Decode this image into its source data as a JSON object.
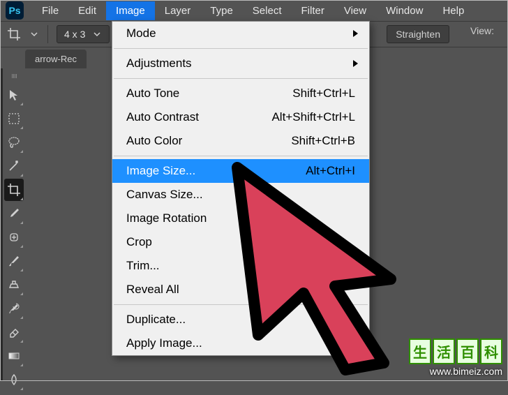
{
  "app": {
    "logo_text": "Ps"
  },
  "menubar": {
    "items": [
      "File",
      "Edit",
      "Image",
      "Layer",
      "Type",
      "Select",
      "Filter",
      "View",
      "Window",
      "Help"
    ],
    "active_index": 2
  },
  "options_bar": {
    "ratio": "4 x 3",
    "straighten": "Straighten",
    "view_label": "View:"
  },
  "document_tab": {
    "title": "arrow-Rec"
  },
  "dropdown": {
    "groups": [
      [
        {
          "label": "Mode",
          "submenu": true
        },
        "sep",
        {
          "label": "Adjustments",
          "submenu": true
        }
      ],
      [
        {
          "label": "Auto Tone",
          "shortcut": "Shift+Ctrl+L"
        },
        {
          "label": "Auto Contrast",
          "shortcut": "Alt+Shift+Ctrl+L"
        },
        {
          "label": "Auto Color",
          "shortcut": "Shift+Ctrl+B"
        }
      ],
      [
        {
          "label": "Image Size...",
          "shortcut": "Alt+Ctrl+I",
          "highlight": true
        },
        {
          "label": "Canvas Size..."
        },
        {
          "label": "Image Rotation"
        },
        {
          "label": "Crop"
        },
        {
          "label": "Trim..."
        },
        {
          "label": "Reveal All"
        }
      ],
      [
        {
          "label": "Duplicate..."
        },
        {
          "label": "Apply Image..."
        }
      ]
    ]
  },
  "watermark": {
    "chars": [
      "生",
      "活",
      "百",
      "科"
    ],
    "url": "www.bimeiz.com"
  }
}
